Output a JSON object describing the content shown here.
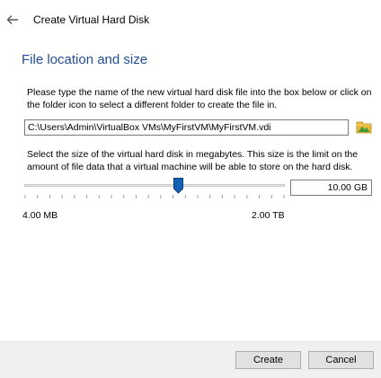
{
  "header": {
    "title": "Create Virtual Hard Disk"
  },
  "section": {
    "title": "File location and size",
    "location_description": "Please type the name of the new virtual hard disk file into the box below or click on the folder icon to select a different folder to create the file in.",
    "file_path": "C:\\Users\\Admin\\VirtualBox VMs\\MyFirstVM\\MyFirstVM.vdi",
    "size_description": "Select the size of the virtual hard disk in megabytes. This size is the limit on the amount of file data that a virtual machine will be able to store on the hard disk."
  },
  "size": {
    "value": "10.00 GB",
    "min_label": "4.00 MB",
    "max_label": "2.00 TB",
    "slider_fraction": 0.59
  },
  "footer": {
    "create_label": "Create",
    "cancel_label": "Cancel"
  },
  "colors": {
    "section_title": "#1f4e96",
    "slider_thumb": "#1460b4",
    "folder_icon": "#e8b83a"
  },
  "icons": {
    "back": "back-arrow-icon",
    "folder": "folder-icon"
  }
}
